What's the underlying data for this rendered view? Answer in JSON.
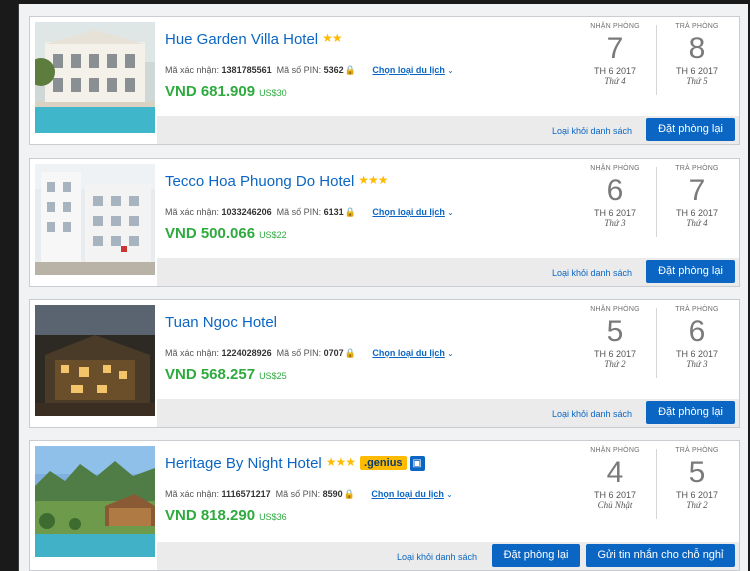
{
  "labels": {
    "checkin": "NHẬN PHÒNG",
    "checkout": "TRẢ PHÒNG",
    "confirmation": "Mã xác nhận:",
    "pin": "Mã số PIN:",
    "choose_trip": "Chọn loại du lịch",
    "remove": "Loại khỏi danh sách",
    "rebook": "Đặt phòng lại",
    "message": "Gửi tin nhắn cho chỗ nghỉ",
    "genius": ".genius"
  },
  "bookings": [
    {
      "name": "Hue Garden Villa Hotel",
      "stars": "★★",
      "confirmation": "1381785561",
      "pin": "5362",
      "price_vnd": "VND 681.909",
      "price_usd": "US$30",
      "checkin": {
        "day": "7",
        "month": "TH 6 2017",
        "weekday": "Thứ 4"
      },
      "checkout": {
        "day": "8",
        "month": "TH 6 2017",
        "weekday": "Thứ 5"
      }
    },
    {
      "name": "Tecco Hoa Phuong Do Hotel",
      "stars": "★★★",
      "confirmation": "1033246206",
      "pin": "6131",
      "price_vnd": "VND 500.066",
      "price_usd": "US$22",
      "checkin": {
        "day": "6",
        "month": "TH 6 2017",
        "weekday": "Thứ 3"
      },
      "checkout": {
        "day": "7",
        "month": "TH 6 2017",
        "weekday": "Thứ 4"
      }
    },
    {
      "name": "Tuan Ngoc Hotel",
      "stars": "",
      "confirmation": "1224028926",
      "pin": "0707",
      "price_vnd": "VND 568.257",
      "price_usd": "US$25",
      "checkin": {
        "day": "5",
        "month": "TH 6 2017",
        "weekday": "Thứ 2"
      },
      "checkout": {
        "day": "6",
        "month": "TH 6 2017",
        "weekday": "Thứ 3"
      }
    },
    {
      "name": "Heritage By Night Hotel",
      "stars": "★★★",
      "confirmation": "1116571217",
      "pin": "8590",
      "price_vnd": "VND 818.290",
      "price_usd": "US$36",
      "checkin": {
        "day": "4",
        "month": "TH 6 2017",
        "weekday": "Chủ Nhật"
      },
      "checkout": {
        "day": "5",
        "month": "TH 6 2017",
        "weekday": "Thứ 2"
      }
    }
  ],
  "colors": {
    "link_blue": "#0b66c3",
    "price_green": "#2eaa3e",
    "star_yellow": "#febb02"
  }
}
